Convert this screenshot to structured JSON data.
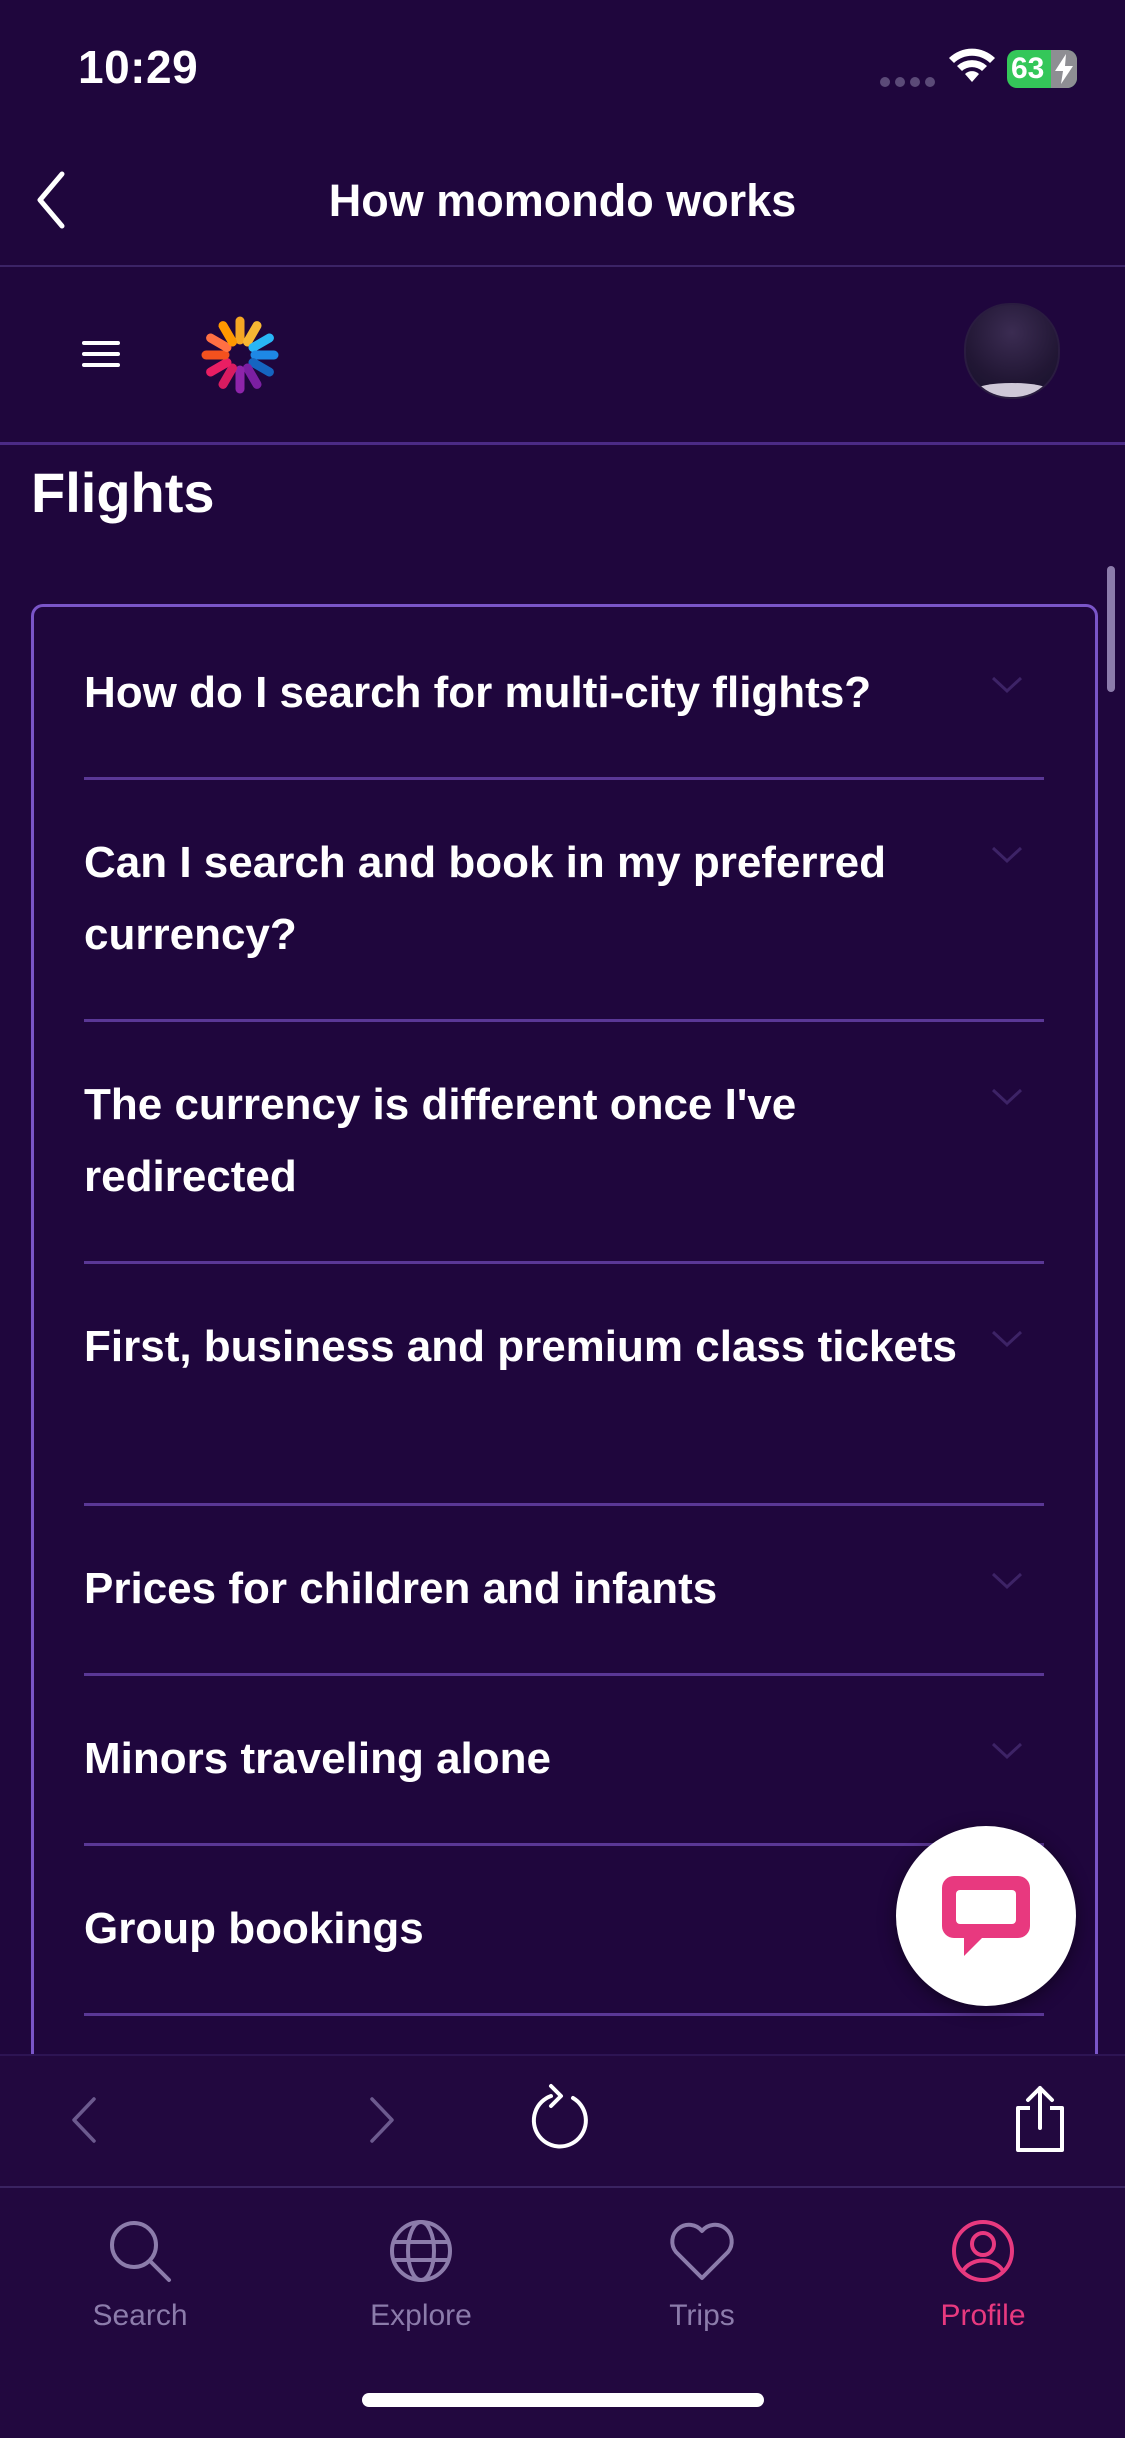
{
  "status_bar": {
    "time": "10:29",
    "battery": "63"
  },
  "navbar": {
    "title": "How momondo works"
  },
  "web_header": {
    "logo": "momondo-logo"
  },
  "section": {
    "title": "Flights"
  },
  "faq": {
    "items": [
      "How do I search for multi-city flights?",
      "Can I search and book in my preferred currency?",
      "The currency is different once I've redirected",
      "First, business and premium class tickets",
      "Prices for children and infants",
      "Minors traveling alone",
      "Group bookings"
    ]
  },
  "tabbar": {
    "tabs": [
      {
        "label": "Search",
        "icon": "search-icon",
        "active": false
      },
      {
        "label": "Explore",
        "icon": "globe-icon",
        "active": false
      },
      {
        "label": "Trips",
        "icon": "heart-icon",
        "active": false
      },
      {
        "label": "Profile",
        "icon": "profile-icon",
        "active": true
      }
    ]
  },
  "colors": {
    "background": "#1f063d",
    "accent": "#e8397f",
    "divider": "#5a3796",
    "box_border": "#7a55c8",
    "inactive": "#8c7cab"
  }
}
